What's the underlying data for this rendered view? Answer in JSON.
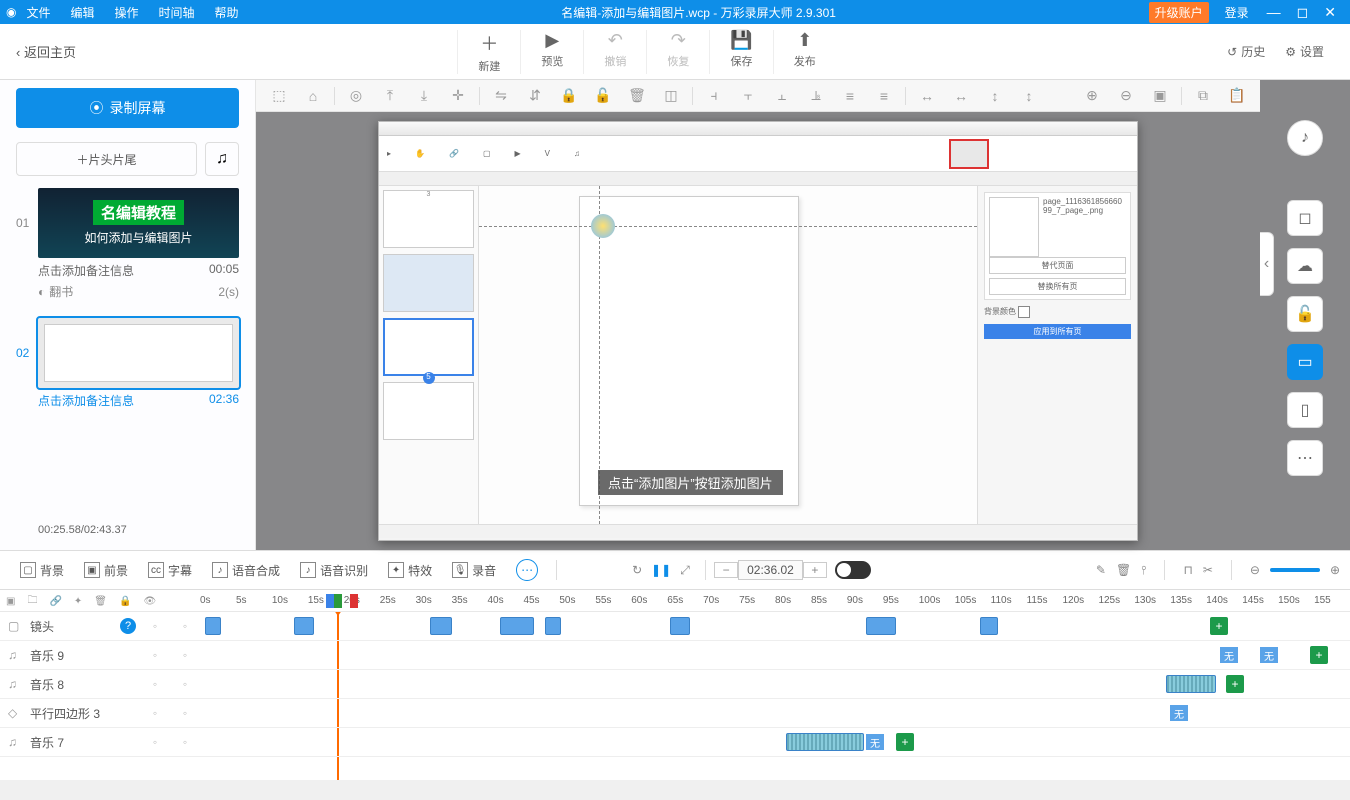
{
  "titlebar": {
    "app_icon": "◉",
    "menus": [
      "文件",
      "编辑",
      "操作",
      "时间轴",
      "帮助"
    ],
    "doc_title": "名编辑-添加与编辑图片.wcp",
    "app_title": "万彩录屏大师 2.9.301",
    "upgrade": "升级账户",
    "login": "登录"
  },
  "topbar": {
    "back": "‹ 返回主页",
    "actions": [
      {
        "icon": "＋",
        "label": "新建"
      },
      {
        "icon": "▶",
        "label": "预览"
      },
      {
        "icon": "↶",
        "label": "撤销",
        "disabled": true
      },
      {
        "icon": "↷",
        "label": "恢复",
        "disabled": true
      },
      {
        "icon": "💾",
        "label": "保存"
      },
      {
        "icon": "⬆",
        "label": "发布"
      }
    ],
    "history": "历史",
    "settings": "设置"
  },
  "left": {
    "record": "录制屏幕",
    "headtail": "片头片尾",
    "clips": [
      {
        "idx": "01",
        "title1": "名编辑教程",
        "title2": "如何添加与编辑图片",
        "note": "点击添加备注信息",
        "time": "00:05",
        "trans": "翻书",
        "trans_t": "2(s)"
      },
      {
        "idx": "02",
        "note": "点击添加备注信息",
        "time": "02:36",
        "selected": true
      }
    ],
    "timestamp": "00:25.58/02:43.37"
  },
  "canvas": {
    "caption": "点击“添加图片”按钮添加图片"
  },
  "timeline_tools": {
    "items": [
      "背景",
      "前景",
      "字幕",
      "语音合成",
      "语音识别",
      "特效",
      "录音"
    ],
    "timecode": "02:36.02"
  },
  "ruler": [
    "0s",
    "5s",
    "10s",
    "15s",
    "20s",
    "25s",
    "30s",
    "35s",
    "40s",
    "45s",
    "50s",
    "55s",
    "60s",
    "65s",
    "70s",
    "75s",
    "80s",
    "85s",
    "90s",
    "95s",
    "100s",
    "105s",
    "110s",
    "115s",
    "120s",
    "125s",
    "130s",
    "135s",
    "140s",
    "145s",
    "150s",
    "155"
  ],
  "tracks": [
    {
      "icon": "▢",
      "name": "镜头",
      "help": true
    },
    {
      "icon": "♫",
      "name": "音乐 9"
    },
    {
      "icon": "♫",
      "name": "音乐 8"
    },
    {
      "icon": "◇",
      "name": "平行四边形 3"
    },
    {
      "icon": "♫",
      "name": "音乐 7"
    }
  ],
  "t_none": "无"
}
